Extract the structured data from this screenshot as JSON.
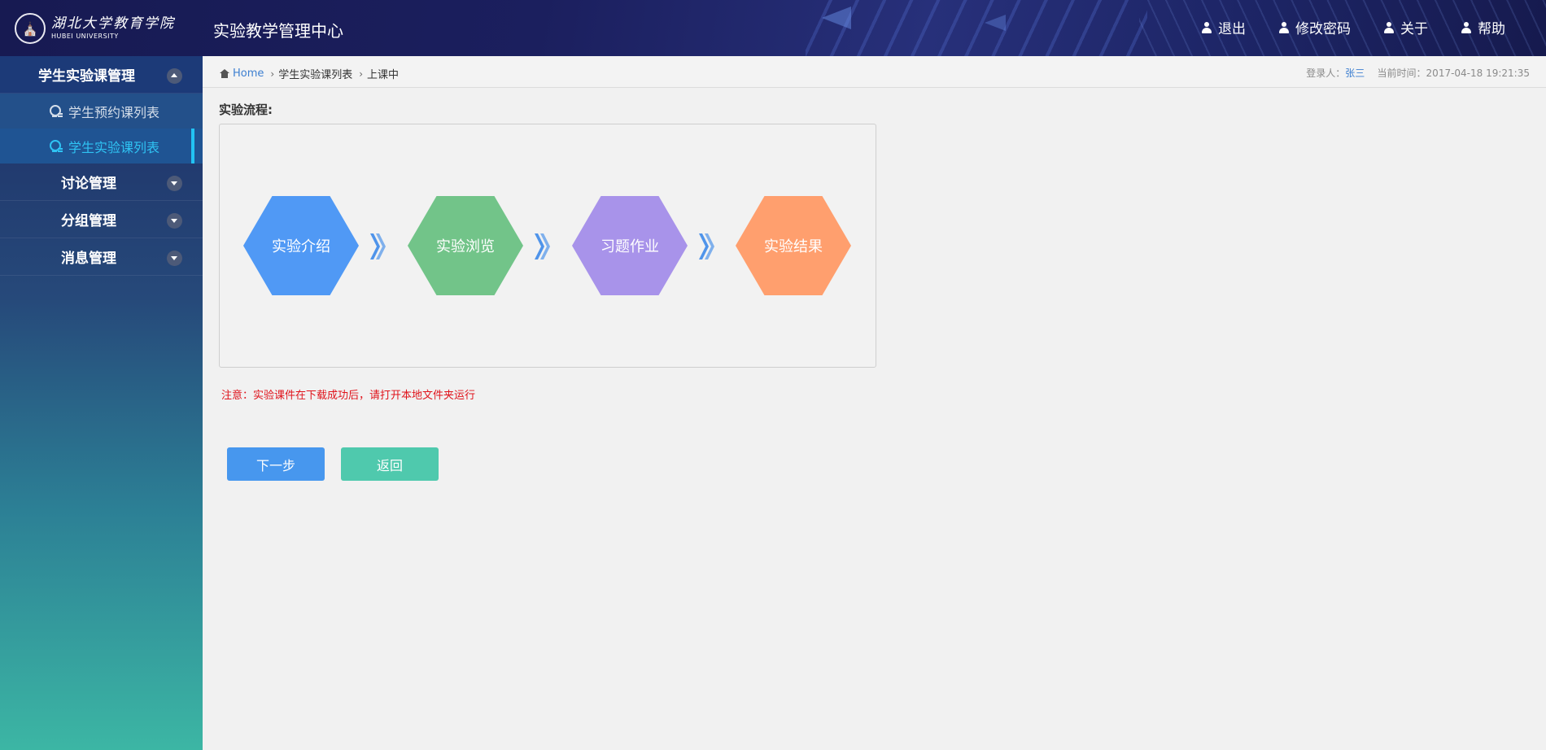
{
  "header": {
    "logo_cn": "湖北大学教育学院",
    "logo_en": "HUBEI UNIVERSITY",
    "system_title": "实验教学管理中心",
    "nav": [
      {
        "label": "退出",
        "icon": "user-icon"
      },
      {
        "label": "修改密码",
        "icon": "user-icon"
      },
      {
        "label": "关于",
        "icon": "user-icon"
      },
      {
        "label": "帮助",
        "icon": "user-icon"
      }
    ]
  },
  "sidebar": {
    "groups": [
      {
        "label": "学生实验课管理",
        "expanded": true,
        "items": [
          {
            "label": "学生预约课列表",
            "active": false
          },
          {
            "label": "学生实验课列表",
            "active": true
          }
        ]
      },
      {
        "label": "讨论管理",
        "expanded": false
      },
      {
        "label": "分组管理",
        "expanded": false
      },
      {
        "label": "消息管理",
        "expanded": false
      }
    ]
  },
  "breadcrumb": {
    "home": "Home",
    "items": [
      "学生实验课列表",
      "上课中"
    ]
  },
  "login_info": {
    "login_label": "登录人：",
    "user_name": "张三",
    "time_label": "当前时间：",
    "time_value": "2017-04-18 19:21:35"
  },
  "flow": {
    "title": "实验流程:",
    "steps": [
      {
        "label": "实验介绍",
        "color": "#5099f5"
      },
      {
        "label": "实验浏览",
        "color": "#72c489"
      },
      {
        "label": "习题作业",
        "color": "#a893ea"
      },
      {
        "label": "实验结果",
        "color": "#ff9f6e"
      }
    ]
  },
  "notice": "注意：实验课件在下载成功后，请打开本地文件夹运行",
  "buttons": {
    "next": "下一步",
    "back": "返回"
  }
}
